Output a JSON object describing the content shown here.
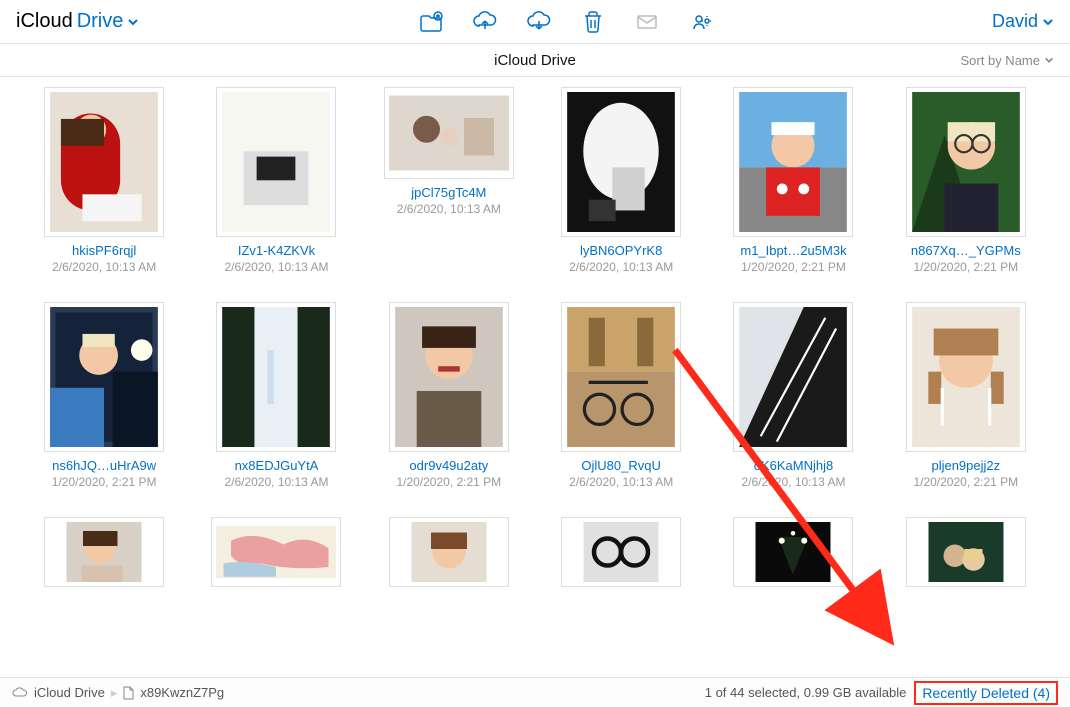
{
  "brand": {
    "icloud": "iCloud ",
    "drive": "Drive"
  },
  "user": "David",
  "location_title": "iCloud Drive",
  "sort_label": "Sort by Name",
  "items": [
    [
      {
        "name": "hkisPF6rqjl",
        "date": "2/6/2020, 10:13 AM",
        "shape": "portrait",
        "thumb": "t1"
      },
      {
        "name": "IZv1-K4ZKVk",
        "date": "2/6/2020, 10:13 AM",
        "shape": "portrait",
        "thumb": "t2"
      },
      {
        "name": "jpCl75gTc4M",
        "date": "2/6/2020, 10:13 AM",
        "shape": "landscape",
        "thumb": "t3"
      },
      {
        "name": "lyBN6OPYrK8",
        "date": "2/6/2020, 10:13 AM",
        "shape": "portrait",
        "thumb": "t4"
      },
      {
        "name": "m1_Ibpt…2u5M3k",
        "date": "1/20/2020, 2:21 PM",
        "shape": "portrait",
        "thumb": "t5"
      },
      {
        "name": "n867Xq…_YGPMs",
        "date": "1/20/2020, 2:21 PM",
        "shape": "portrait",
        "thumb": "t6"
      }
    ],
    [
      {
        "name": "ns6hJQ…uHrA9w",
        "date": "1/20/2020, 2:21 PM",
        "shape": "portrait",
        "thumb": "t7"
      },
      {
        "name": "nx8EDJGuYtA",
        "date": "2/6/2020, 10:13 AM",
        "shape": "portrait",
        "thumb": "t8"
      },
      {
        "name": "odr9v49u2aty",
        "date": "1/20/2020, 2:21 PM",
        "shape": "portrait",
        "thumb": "t9"
      },
      {
        "name": "OjlU80_RvqU",
        "date": "2/6/2020, 10:13 AM",
        "shape": "portrait",
        "thumb": "t10"
      },
      {
        "name": "oK6KaMNjhj8",
        "date": "2/6/2020, 10:13 AM",
        "shape": "portrait",
        "thumb": "t11"
      },
      {
        "name": "pljen9pejj2z",
        "date": "1/20/2020, 2:21 PM",
        "shape": "portrait",
        "thumb": "t12"
      }
    ],
    [
      {
        "name": "",
        "date": "",
        "shape": "portrait",
        "thumb": "t13"
      },
      {
        "name": "",
        "date": "",
        "shape": "landscape",
        "thumb": "t14"
      },
      {
        "name": "",
        "date": "",
        "shape": "portrait",
        "thumb": "t15"
      },
      {
        "name": "",
        "date": "",
        "shape": "portrait",
        "thumb": "t16"
      },
      {
        "name": "",
        "date": "",
        "shape": "portrait",
        "thumb": "t17"
      },
      {
        "name": "",
        "date": "",
        "shape": "portrait",
        "thumb": "t18"
      }
    ]
  ],
  "breadcrumbs": {
    "root": "iCloud Drive",
    "current": "x89KwznZ7Pg"
  },
  "status": "1 of 44 selected, 0.99 GB available",
  "recently_deleted": "Recently Deleted (4)"
}
